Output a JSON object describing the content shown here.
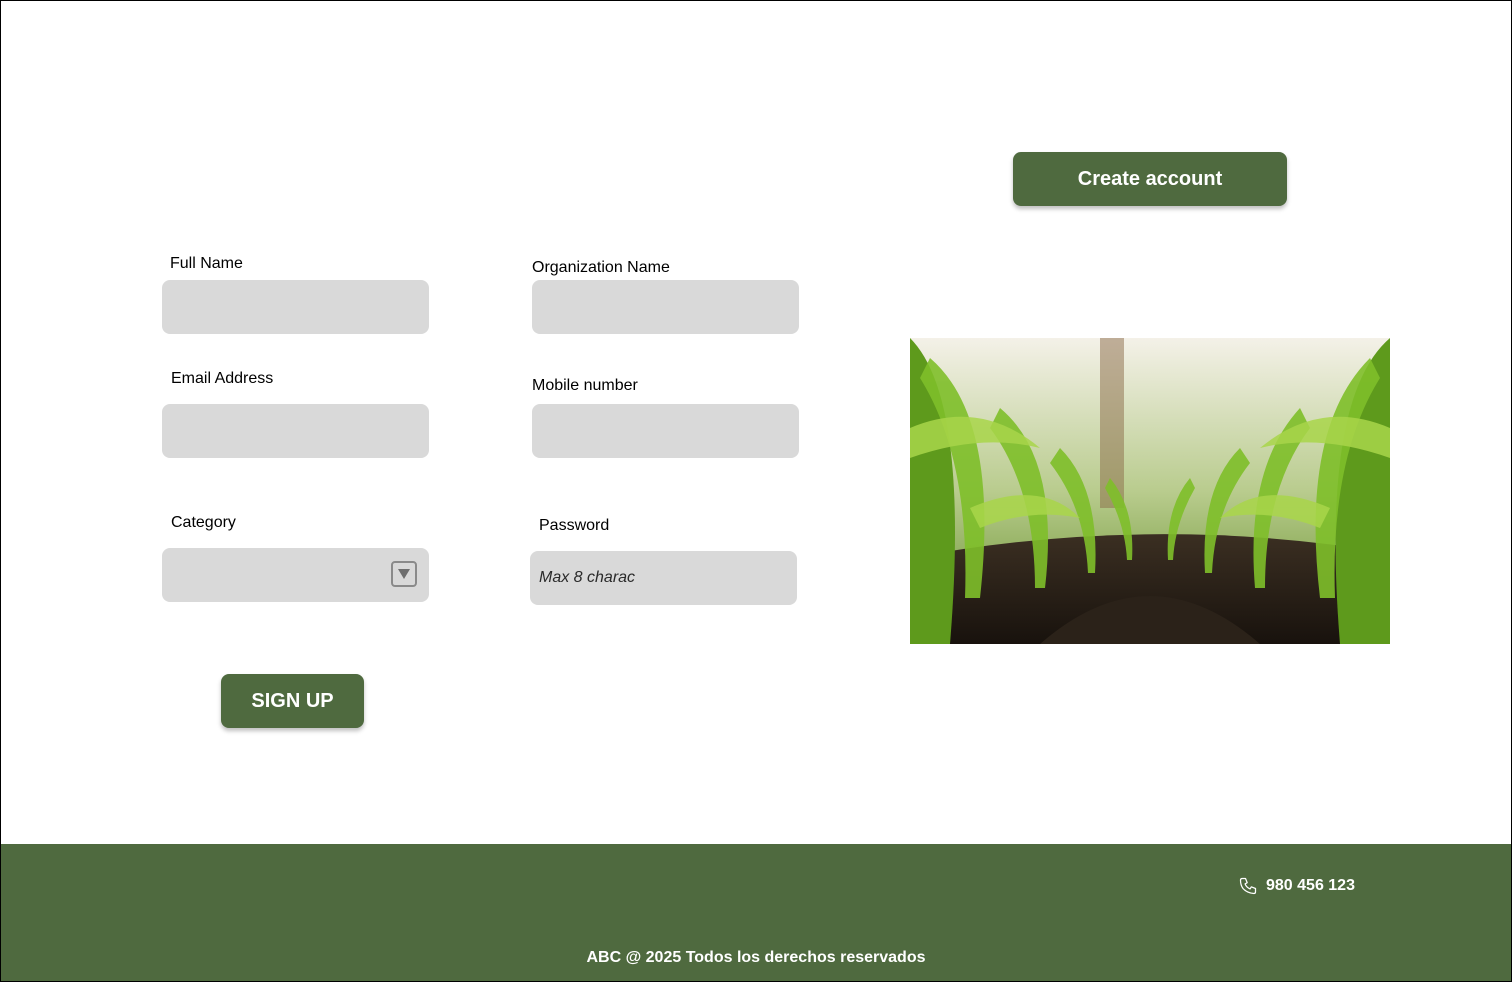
{
  "header": {
    "create_account_label": "Create account"
  },
  "form": {
    "full_name": {
      "label": "Full Name",
      "value": "",
      "placeholder": ""
    },
    "organization_name": {
      "label": "Organization Name",
      "value": "",
      "placeholder": ""
    },
    "email": {
      "label": "Email Address",
      "value": "",
      "placeholder": ""
    },
    "mobile": {
      "label": "Mobile number",
      "value": "",
      "placeholder": ""
    },
    "category": {
      "label": "Category",
      "selected": ""
    },
    "password": {
      "label": "Password",
      "value": "",
      "placeholder": "Max 8 charac"
    },
    "sign_up_label": "SIGN UP"
  },
  "footer": {
    "phone": "980 456 123",
    "copyright": "ABC @ 2025 Todos los derechos reservados"
  },
  "colors": {
    "brand": "#4f6a3f",
    "field_bg": "#d9d9d9"
  },
  "icons": {
    "dropdown": "caret-down-icon",
    "phone": "phone-icon"
  }
}
